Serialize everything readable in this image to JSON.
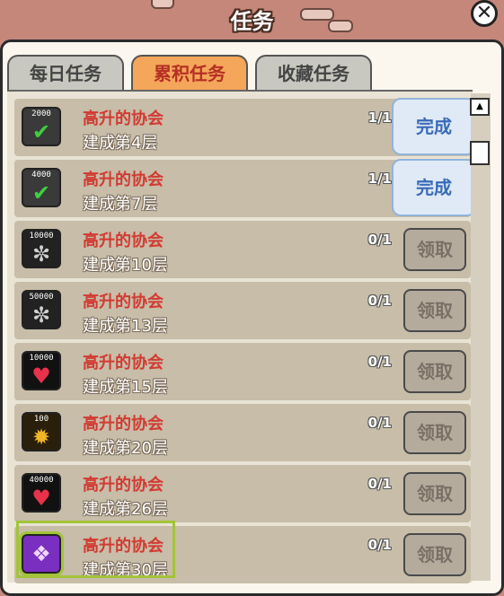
{
  "window": {
    "title": "任务",
    "close_label": "✕"
  },
  "tabs": [
    {
      "label": "每日任务",
      "active": false
    },
    {
      "label": "累积任务",
      "active": true
    },
    {
      "label": "收藏任务",
      "active": false
    }
  ],
  "tasks": [
    {
      "name": "高升的协会",
      "desc": "建成第4层",
      "progress": "1/1",
      "button": "完成",
      "status": "complete",
      "icon": "check-coin-icon",
      "icon_value": "2000"
    },
    {
      "name": "高升的协会",
      "desc": "建成第7层",
      "progress": "1/1",
      "button": "完成",
      "status": "complete",
      "icon": "check-coin-icon",
      "icon_value": "4000"
    },
    {
      "name": "高升的协会",
      "desc": "建成第10层",
      "progress": "0/1",
      "button": "领取",
      "status": "locked",
      "icon": "silver-coin-icon",
      "icon_value": "10000"
    },
    {
      "name": "高升的协会",
      "desc": "建成第13层",
      "progress": "0/1",
      "button": "领取",
      "status": "locked",
      "icon": "silver-coin-icon",
      "icon_value": "50000"
    },
    {
      "name": "高升的协会",
      "desc": "建成第15层",
      "progress": "0/1",
      "button": "领取",
      "status": "locked",
      "icon": "heart-icon",
      "icon_value": "10000"
    },
    {
      "name": "高升的协会",
      "desc": "建成第20层",
      "progress": "0/1",
      "button": "领取",
      "status": "locked",
      "icon": "gold-coin-icon",
      "icon_value": "100"
    },
    {
      "name": "高升的协会",
      "desc": "建成第26层",
      "progress": "0/1",
      "button": "领取",
      "status": "locked",
      "icon": "heart-icon",
      "icon_value": "40000"
    },
    {
      "name": "高升的协会",
      "desc": "建成第30层",
      "progress": "0/1",
      "button": "领取",
      "status": "locked",
      "icon": "gift-card-icon",
      "icon_value": ""
    }
  ],
  "scrollbar": {
    "up_arrow": "▲"
  },
  "colors": {
    "accent": "#f4a65a",
    "title_red": "#d23a32",
    "done_blue": "#3a6bb8"
  }
}
